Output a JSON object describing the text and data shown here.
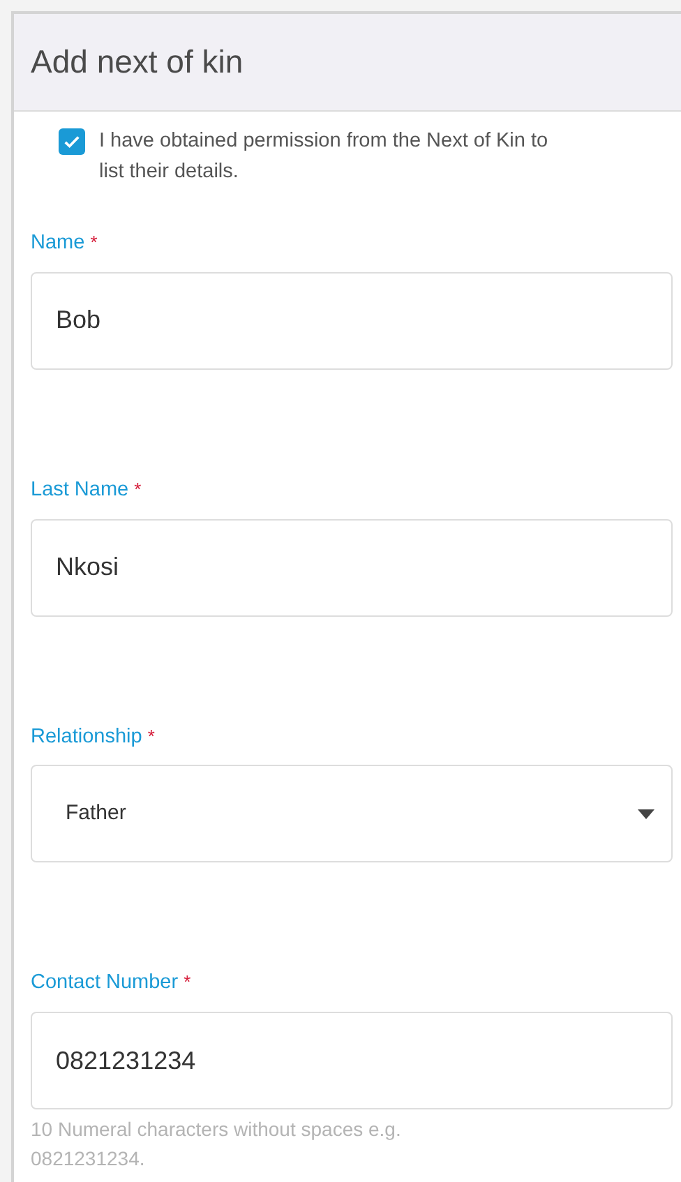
{
  "title": "Add next of kin",
  "consent": {
    "label": "I have obtained permission from the Next of Kin to list their details.",
    "checked": true
  },
  "fields": [
    {
      "kind": "text",
      "label": "Name",
      "required_mark": "*",
      "value": "Bob"
    },
    {
      "kind": "text",
      "label": "Last Name",
      "required_mark": "*",
      "value": "Nkosi"
    },
    {
      "kind": "select",
      "label": "Relationship",
      "required_mark": "*",
      "value": "Father"
    },
    {
      "kind": "text",
      "label": "Contact Number",
      "required_mark": "*",
      "value": "0821231234",
      "hint": "10 Numeral characters without spaces e.g. 0821231234."
    }
  ]
}
